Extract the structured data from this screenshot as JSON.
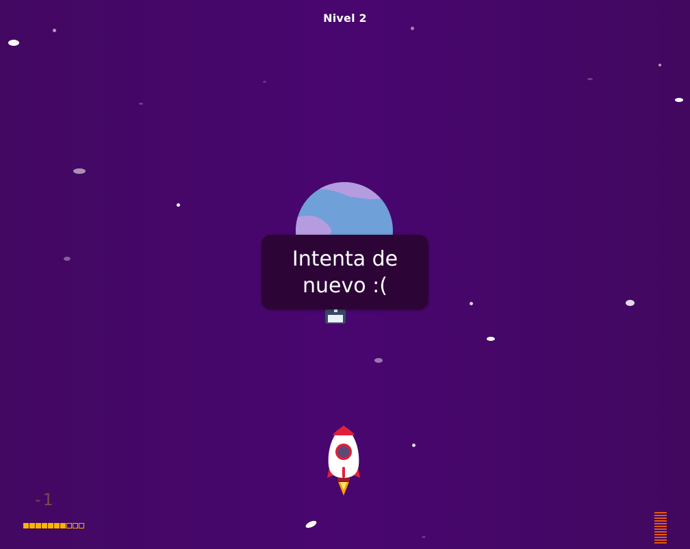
{
  "hud": {
    "level_label": "Nivel 2",
    "score": "-1",
    "progress": {
      "filled": 7,
      "total": 10
    },
    "gauge": {
      "bars": 12
    }
  },
  "dialog": {
    "message": "Intenta de nuevo :("
  },
  "sprites": {
    "planet": "planet-icon",
    "rocket": "rocket-icon",
    "item": "window-box-icon"
  },
  "colors": {
    "background": "#46086a",
    "dialog": "#2c0536",
    "progress": "#f8b400",
    "gauge": "#e85a10",
    "score": "#7c4a46"
  }
}
